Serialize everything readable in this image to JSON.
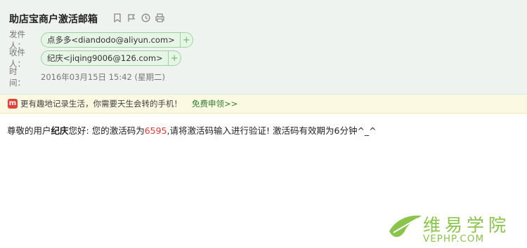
{
  "header": {
    "subject": "助店宝商户激活邮箱",
    "tools": [
      "bookmark-icon",
      "flag-icon",
      "clock-icon",
      "print-icon"
    ],
    "sender_label": "发件人：",
    "sender": "点多多<diandodo@aliyun.com>",
    "recipient_label": "收件人：",
    "recipient": "纪庆<jiqing9006@126.com>",
    "add_symbol": "+",
    "time_label": "时　间：",
    "time_value": "2016年03月15日 15:42 (星期二)"
  },
  "promo": {
    "icon_text": "m",
    "text": "更有趣地记录生活，你需要天生会转的手机！",
    "link": "免费申领>>"
  },
  "body": {
    "greeting_prefix": "尊敬的用户",
    "user_name": "纪庆",
    "greeting_suffix": "您好: 您的激活码为",
    "code": "6595",
    "message": ",请将激活码输入进行验证! 激活码有效期为6分钟^_^"
  },
  "watermark": {
    "cn": "维易学院",
    "en": "VEPHP.COM",
    "accent": "#8ac44a"
  },
  "colors": {
    "header_bg": "#eef3ef",
    "contact_border": "#9fd29f",
    "promo_bg": "#fcf9e3",
    "code": "#e53935"
  }
}
